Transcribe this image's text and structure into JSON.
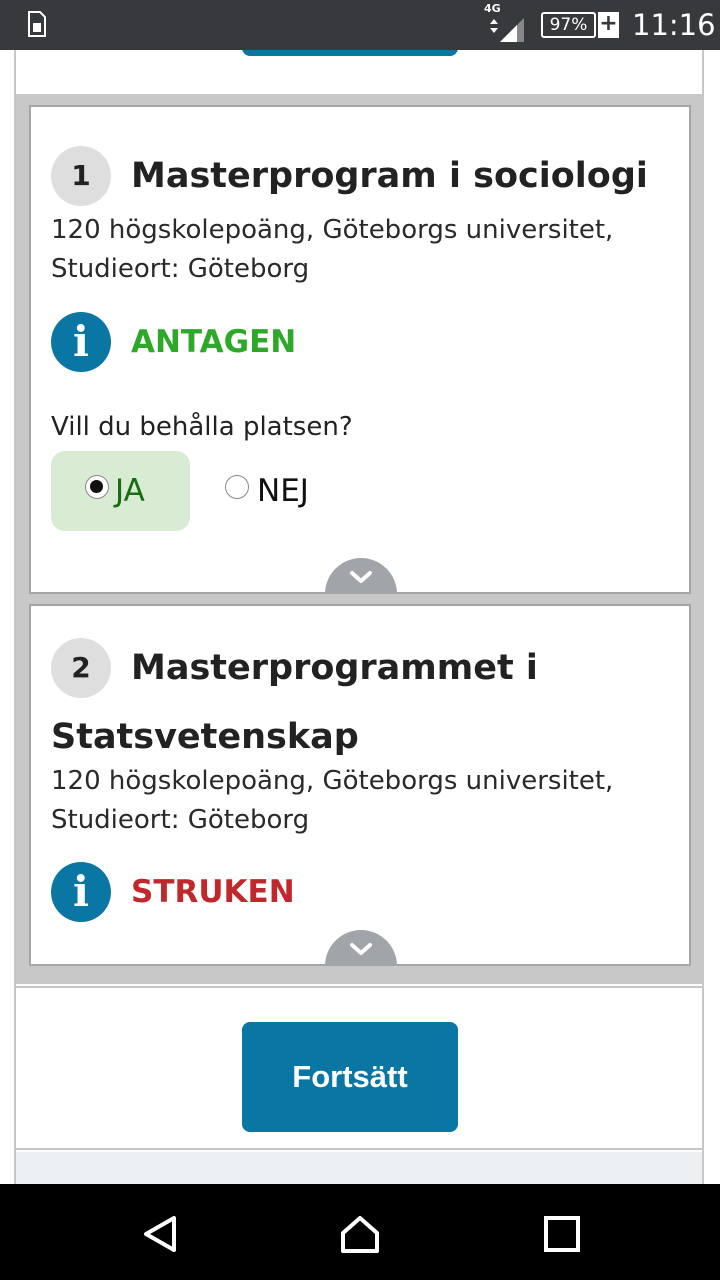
{
  "status_bar": {
    "network": "4G",
    "battery": "97%",
    "battery_plus": "+",
    "time": "11:16"
  },
  "applications": [
    {
      "number": "1",
      "title": "Masterprogram i sociologi",
      "title_line2": "",
      "credits_line": "120 högskolepoäng, Göteborgs universitet,",
      "location_line": "Studieort: Göteborg",
      "status": "ANTAGEN",
      "question": "Vill du behålla platsen?",
      "options": [
        {
          "label": "JA",
          "selected": true
        },
        {
          "label": "NEJ",
          "selected": false
        }
      ]
    },
    {
      "number": "2",
      "title": "Masterprogrammet i",
      "title_line2": "Statsvetenskap",
      "credits_line": "120 högskolepoäng, Göteborgs universitet,",
      "location_line": "Studieort: Göteborg",
      "status": "STRUKEN"
    }
  ],
  "continue_button": "Fortsätt",
  "colors": {
    "accent": "#0a76a4",
    "accepted": "#2ea829",
    "rejected": "#c0282b",
    "selected_option_bg": "#d7ecd3"
  }
}
